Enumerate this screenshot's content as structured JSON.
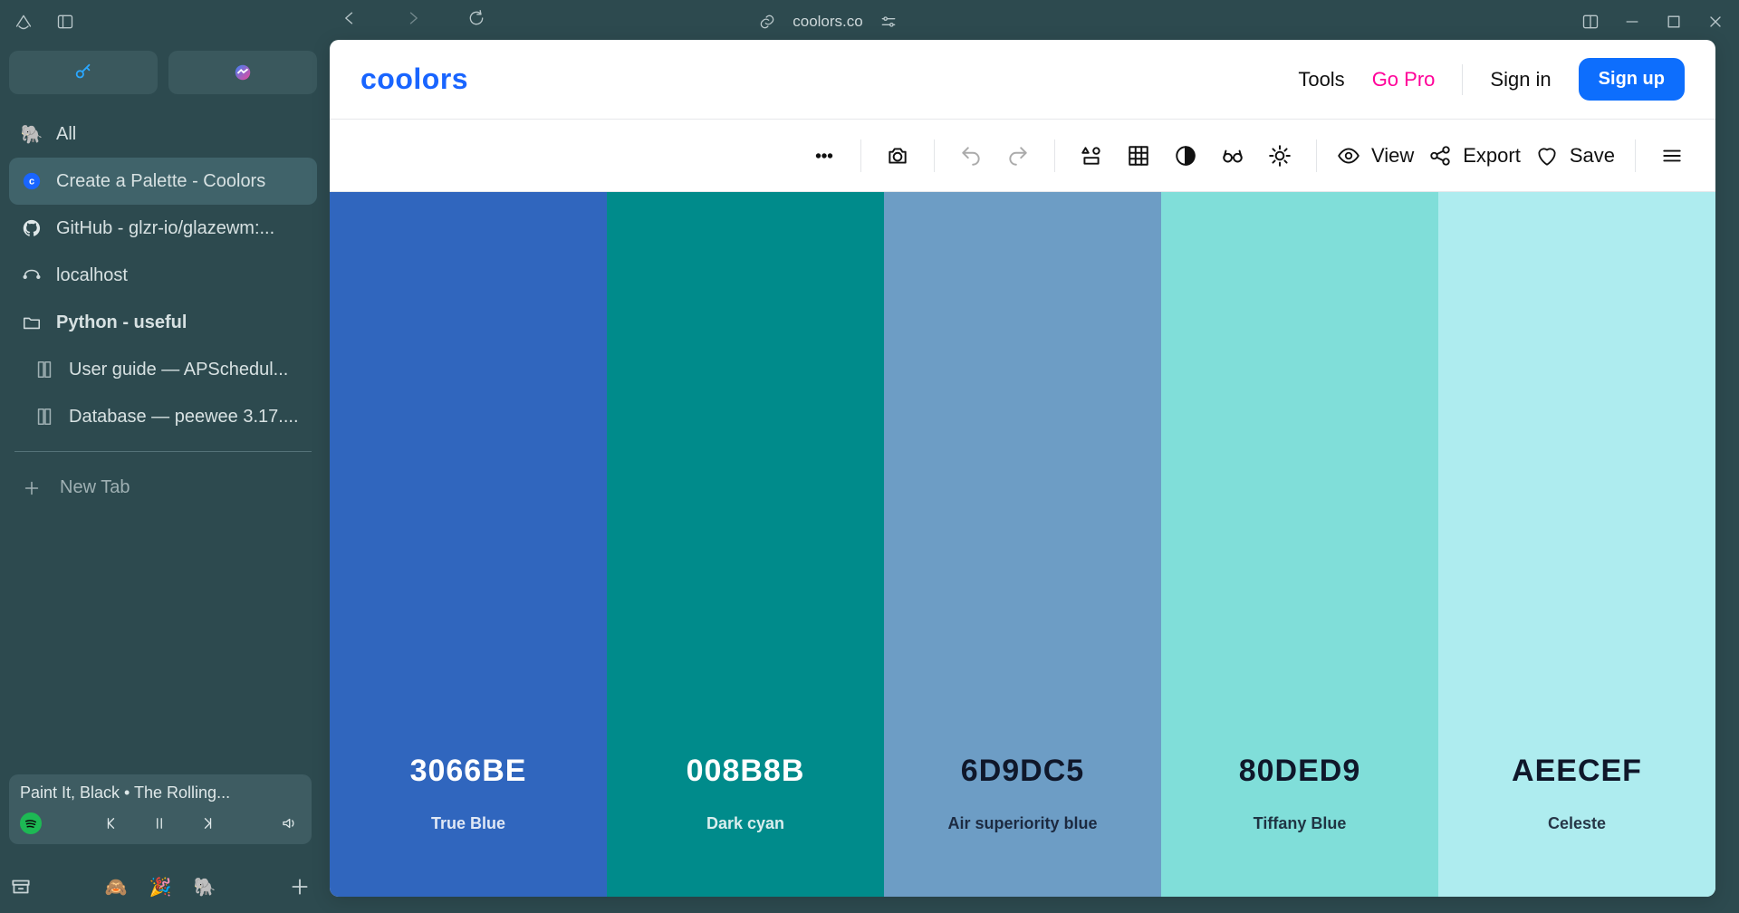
{
  "browser": {
    "url": "coolors.co",
    "window": {
      "minimize": "minimize",
      "maximize": "maximize",
      "close": "close"
    }
  },
  "pills": [
    {
      "id": "key-pill",
      "icon": "key-icon"
    },
    {
      "id": "messenger-pill",
      "icon": "messenger-icon"
    }
  ],
  "sidebar": {
    "all_label": "All",
    "tabs": [
      {
        "id": "coolors",
        "label": "Create a Palette - Coolors",
        "active": true,
        "favicon": "coolors-favicon"
      },
      {
        "id": "github",
        "label": "GitHub - glzr-io/glazewm:...",
        "active": false,
        "favicon": "github-favicon"
      },
      {
        "id": "localhost",
        "label": "localhost",
        "active": false,
        "favicon": "localhost-icon"
      }
    ],
    "group_label": "Python - useful",
    "group_items": [
      {
        "id": "apscheduler",
        "label": "User guide — APSchedul..."
      },
      {
        "id": "peewee",
        "label": "Database — peewee 3.17...."
      }
    ],
    "new_tab_label": "New Tab"
  },
  "media": {
    "title": "Paint It, Black • The Rolling..."
  },
  "app": {
    "logo_text": "coolors",
    "nav": {
      "tools": "Tools",
      "gopro": "Go Pro",
      "signin": "Sign in",
      "signup": "Sign up"
    },
    "toolbar": {
      "view": "View",
      "export": "Export",
      "save": "Save"
    },
    "palette": [
      {
        "hex": "3066BE",
        "name": "True Blue",
        "bg": "#3066BE",
        "text": "light"
      },
      {
        "hex": "008B8B",
        "name": "Dark cyan",
        "bg": "#008B8B",
        "text": "light"
      },
      {
        "hex": "6D9DC5",
        "name": "Air superiority blue",
        "bg": "#6D9DC5",
        "text": "dark"
      },
      {
        "hex": "80DED9",
        "name": "Tiffany Blue",
        "bg": "#80DED9",
        "text": "dark"
      },
      {
        "hex": "AEECEF",
        "name": "Celeste",
        "bg": "#AEECEF",
        "text": "dark"
      }
    ]
  }
}
